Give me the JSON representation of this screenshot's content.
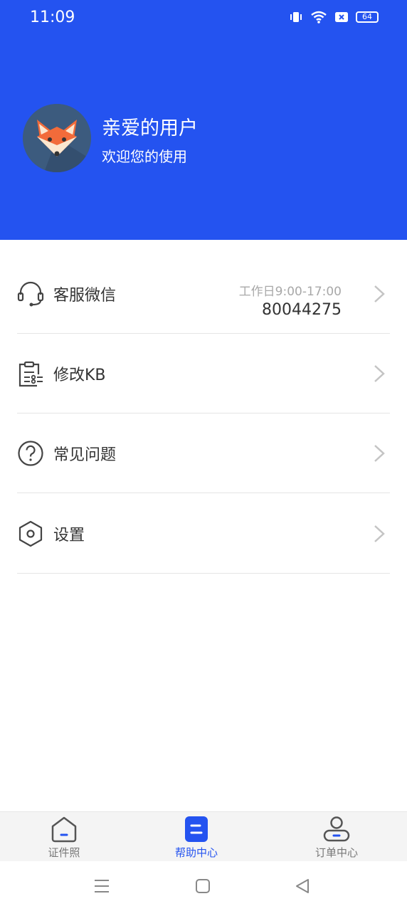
{
  "status_bar": {
    "time": "11:09",
    "battery": "64"
  },
  "profile": {
    "name": "亲爱的用户",
    "subtitle": "欢迎您的使用"
  },
  "menu": {
    "items": [
      {
        "label": "客服微信",
        "hours": "工作日9:00-17:00",
        "phone": "80044275",
        "icon": "headset-icon"
      },
      {
        "label": "修改KB",
        "icon": "clipboard-icon"
      },
      {
        "label": "常见问题",
        "icon": "question-icon"
      },
      {
        "label": "设置",
        "icon": "hexagon-settings-icon"
      }
    ]
  },
  "bottom_nav": {
    "tabs": [
      {
        "label": "证件照",
        "icon": "home-icon",
        "active": false
      },
      {
        "label": "帮助中心",
        "icon": "help-doc-icon",
        "active": true
      },
      {
        "label": "订单中心",
        "icon": "user-icon",
        "active": false
      }
    ]
  },
  "colors": {
    "primary": "#2453F0",
    "header_bg": "#2453F0",
    "text": "#333333",
    "muted": "#a8a8a8"
  }
}
